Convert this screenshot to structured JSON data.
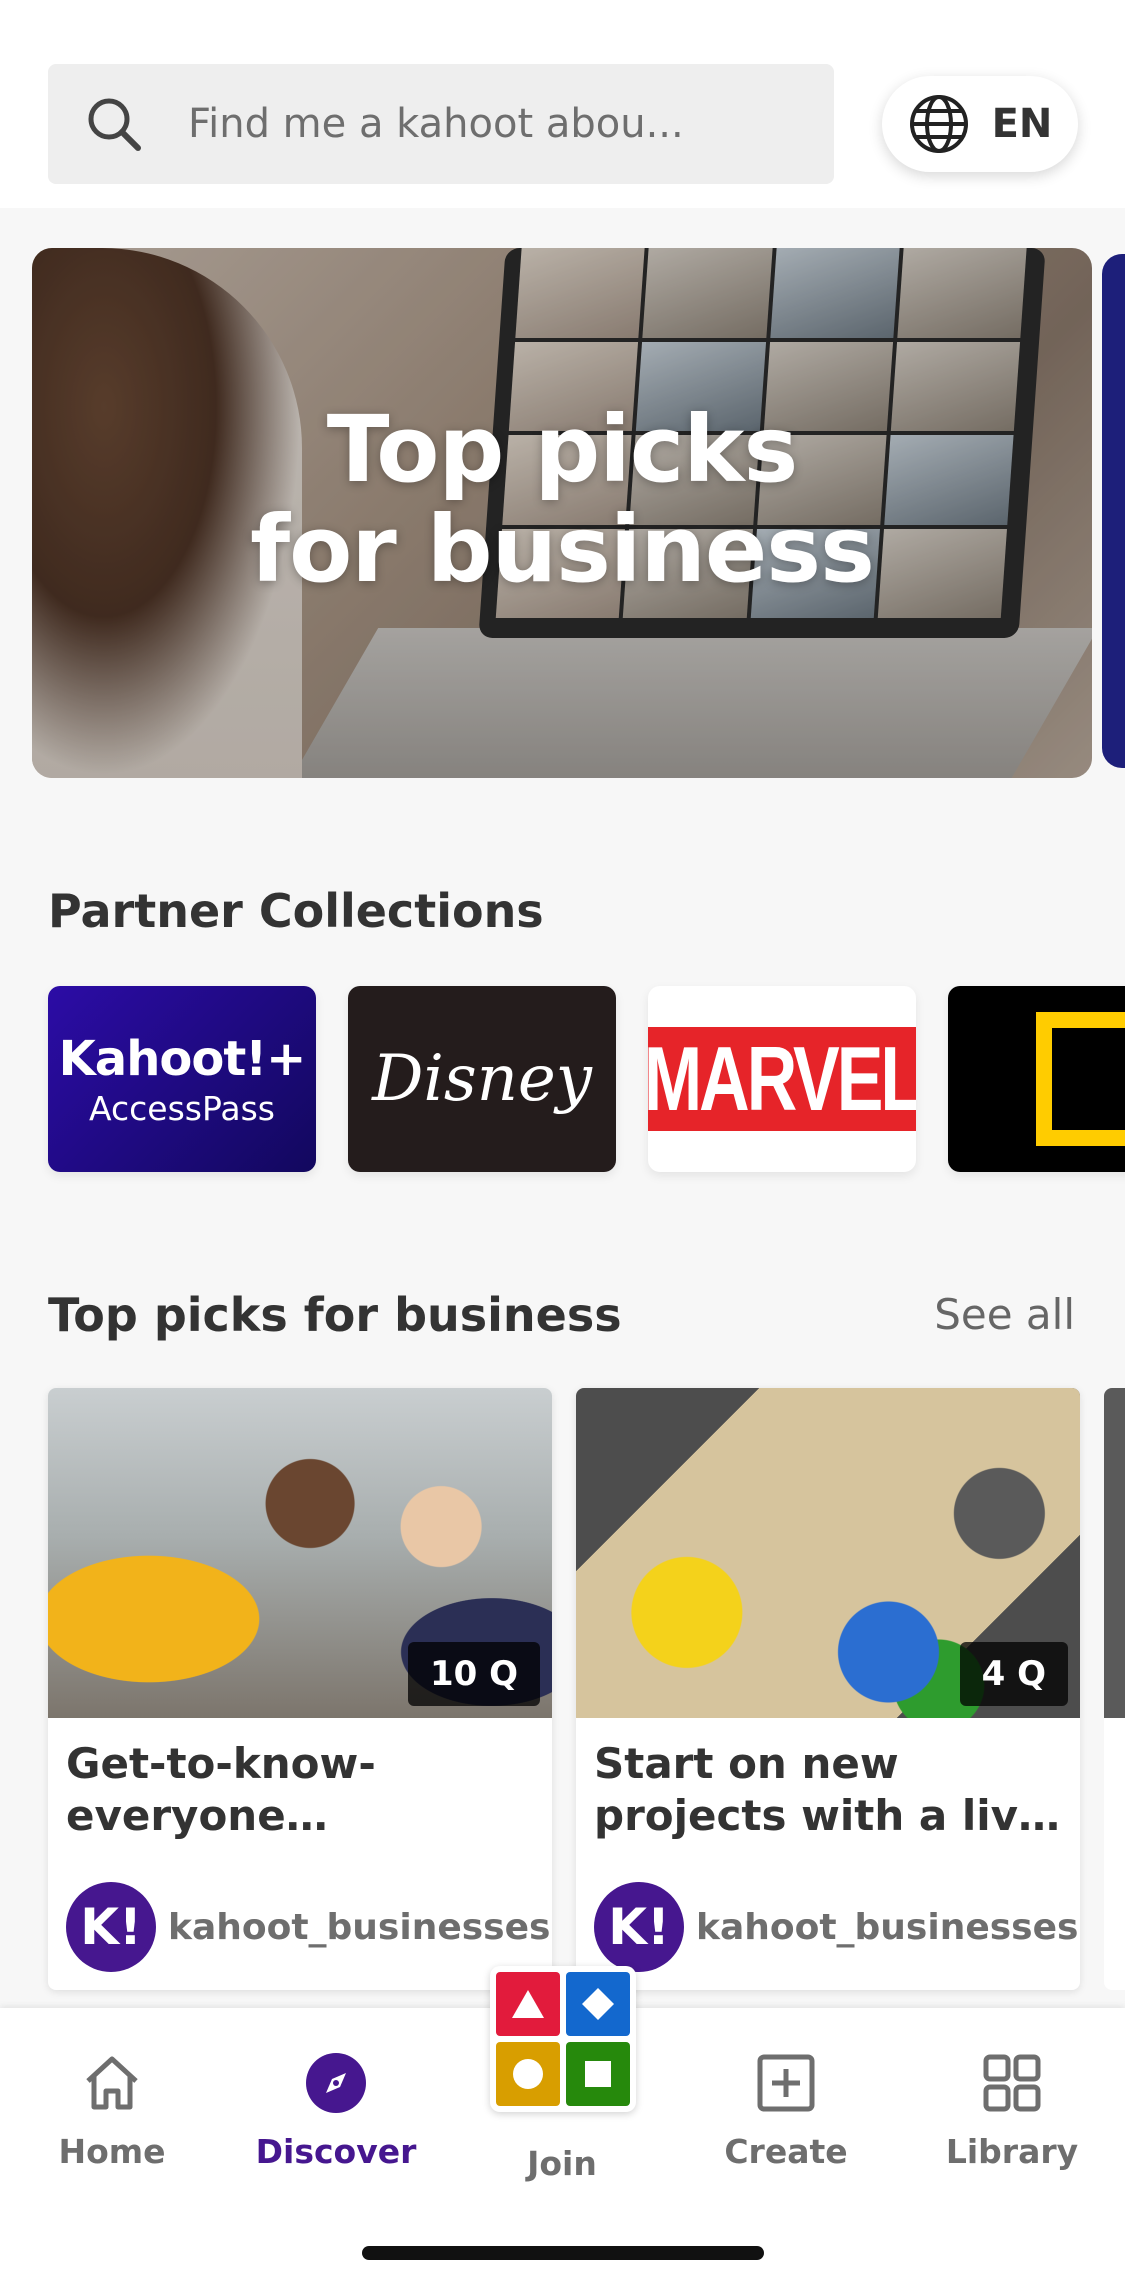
{
  "search": {
    "placeholder": "Find me a kahoot abou..."
  },
  "language": {
    "code": "EN",
    "icon": "globe-icon"
  },
  "hero": {
    "title_line1": "Top picks",
    "title_line2": "for business"
  },
  "partner_collections": {
    "title": "Partner Collections",
    "items": [
      {
        "name": "Kahoot!+ AccessPass",
        "line1": "Kahoot!+",
        "line2": "AccessPass",
        "color": "#2c0ca6"
      },
      {
        "name": "Disney",
        "line1": "Disney",
        "color": "#241c1c"
      },
      {
        "name": "Marvel",
        "line1": "MARVEL",
        "color": "#e62429"
      },
      {
        "name": "National Geographic",
        "color": "#ffcc00"
      }
    ]
  },
  "top_picks": {
    "title": "Top picks for business",
    "see_all": "See all",
    "cards": [
      {
        "title": "Get-to-know-everyone icebreaker",
        "questions": "10 Q",
        "creator": "kahoot_businesses",
        "avatar": "K!"
      },
      {
        "title": "Start on new projects with a live kahoot",
        "questions": "4 Q",
        "creator": "kahoot_businesses",
        "avatar": "K!"
      }
    ]
  },
  "nav": {
    "active": "Discover",
    "accent": "#46178f",
    "items": [
      {
        "label": "Home",
        "icon": "home-icon"
      },
      {
        "label": "Discover",
        "icon": "compass-icon"
      },
      {
        "label": "Join",
        "icon": "join-shapes-icon"
      },
      {
        "label": "Create",
        "icon": "plus-square-icon"
      },
      {
        "label": "Library",
        "icon": "grid-icon"
      }
    ],
    "join_colors": [
      "#e21b3c",
      "#1368ce",
      "#d89e00",
      "#26890c"
    ]
  }
}
